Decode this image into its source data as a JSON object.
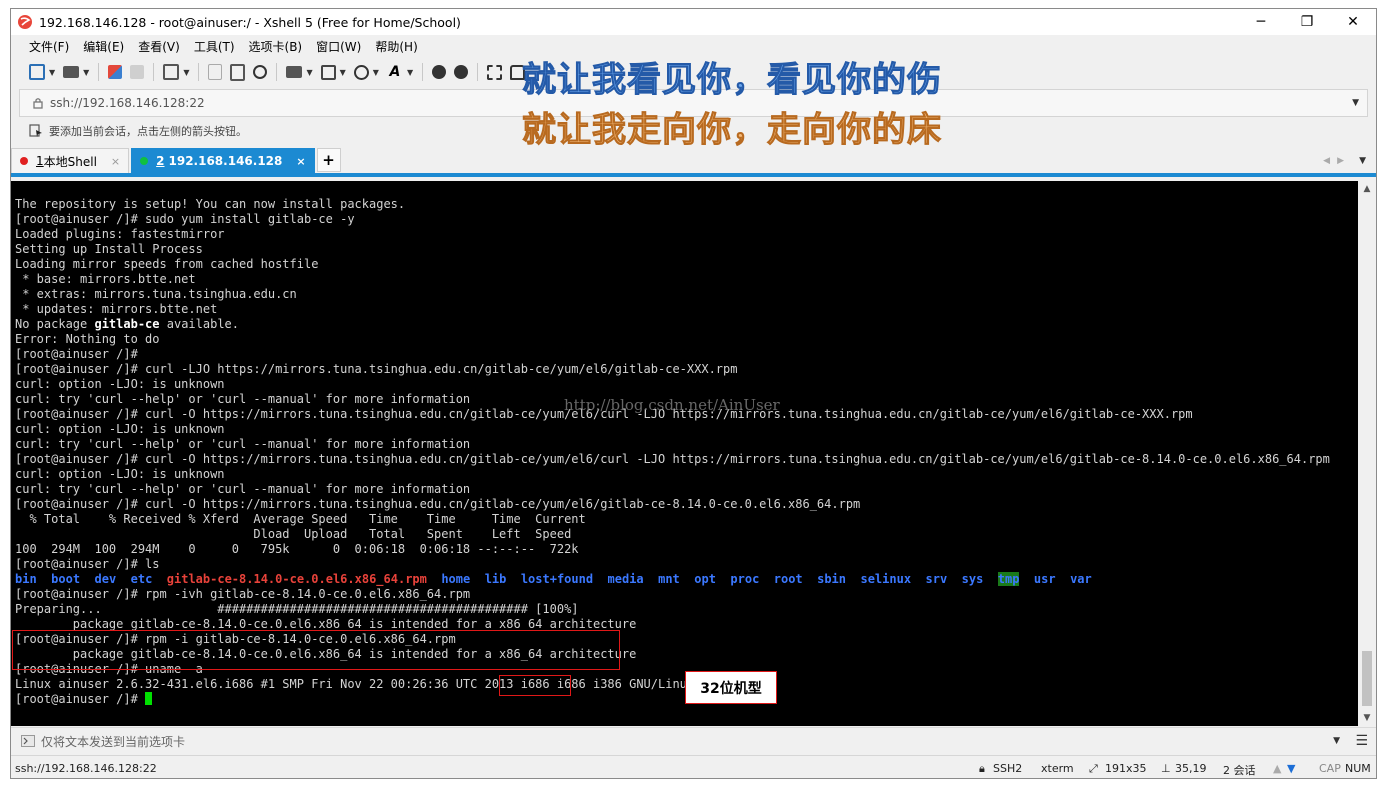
{
  "window": {
    "title": "192.168.146.128 - root@ainuser:/ - Xshell 5 (Free for Home/School)",
    "minimize_glyph": "─",
    "maximize_glyph": "❐",
    "close_glyph": "✕"
  },
  "menu": [
    "文件(F)",
    "编辑(E)",
    "查看(V)",
    "工具(T)",
    "选项卡(B)",
    "窗口(W)",
    "帮助(H)"
  ],
  "toolbar_icons": [
    "new-session-icon",
    "open-folder-icon",
    "connect-icon",
    "disconnect-icon",
    "properties-icon",
    "copy-icon",
    "paste-icon",
    "find-icon",
    "print-icon",
    "transfer-icon",
    "globe-icon",
    "font-icon",
    "xftp-icon",
    "xmanager-icon",
    "fullscreen-icon",
    "lock-icon",
    "keyboard-icon",
    "help-icon"
  ],
  "address": {
    "text": "ssh://192.168.146.128:22"
  },
  "info": {
    "text": "要添加当前会话，点击左侧的箭头按钮。"
  },
  "tabs": [
    {
      "number": "1",
      "label": "本地Shell",
      "dot_color": "#e02020",
      "active": false,
      "close_glyph": "×"
    },
    {
      "number": "2",
      "label": "192.168.146.128",
      "dot_color": "#10c040",
      "active": true,
      "close_glyph": "×"
    }
  ],
  "tab_add_glyph": "+",
  "lyrics": [
    "就让我看见你，看见你的伤",
    "就让我走向你，走向你的床"
  ],
  "watermark": "http://blog.csdn.net/AinUser",
  "terminal": {
    "lines": [
      "The repository is setup! You can now install packages.",
      "[root@ainuser /]# sudo yum install gitlab-ce -y",
      "Loaded plugins: fastestmirror",
      "Setting up Install Process",
      "Loading mirror speeds from cached hostfile",
      " * base: mirrors.btte.net",
      " * extras: mirrors.tuna.tsinghua.edu.cn",
      " * updates: mirrors.btte.net"
    ],
    "no_package": {
      "prefix": "No package ",
      "bold": "gitlab-ce",
      "suffix": " available."
    },
    "lines2": [
      "Error: Nothing to do",
      "[root@ainuser /]#",
      "[root@ainuser /]# curl -LJO https://mirrors.tuna.tsinghua.edu.cn/gitlab-ce/yum/el6/gitlab-ce-XXX.rpm",
      "curl: option -LJO: is unknown",
      "curl: try 'curl --help' or 'curl --manual' for more information",
      "[root@ainuser /]# curl -O https://mirrors.tuna.tsinghua.edu.cn/gitlab-ce/yum/el6/curl -LJO https://mirrors.tuna.tsinghua.edu.cn/gitlab-ce/yum/el6/gitlab-ce-XXX.rpm",
      "curl: option -LJO: is unknown",
      "curl: try 'curl --help' or 'curl --manual' for more information",
      "[root@ainuser /]# curl -O https://mirrors.tuna.tsinghua.edu.cn/gitlab-ce/yum/el6/curl -LJO https://mirrors.tuna.tsinghua.edu.cn/gitlab-ce/yum/el6/gitlab-ce-8.14.0-ce.0.el6.x86_64.rpm",
      "curl: option -LJO: is unknown",
      "curl: try 'curl --help' or 'curl --manual' for more information",
      "[root@ainuser /]# curl -O https://mirrors.tuna.tsinghua.edu.cn/gitlab-ce/yum/el6/gitlab-ce-8.14.0-ce.0.el6.x86_64.rpm",
      "  % Total    % Received % Xferd  Average Speed   Time    Time     Time  Current",
      "                                 Dload  Upload   Total   Spent    Left  Speed",
      "100  294M  100  294M    0     0   795k      0  0:06:18  0:06:18 --:--:--  722k",
      "[root@ainuser /]# ls"
    ],
    "ls": {
      "before": [
        "bin",
        "boot",
        "dev",
        "etc"
      ],
      "rpm": "gitlab-ce-8.14.0-ce.0.el6.x86_64.rpm",
      "after": [
        "home",
        "lib",
        "lost+found",
        "media",
        "mnt",
        "opt",
        "proc",
        "root",
        "sbin",
        "selinux",
        "srv",
        "sys"
      ],
      "tmp": "tmp",
      "end": [
        "usr",
        "var"
      ]
    },
    "lines3": [
      "[root@ainuser /]# rpm -ivh gitlab-ce-8.14.0-ce.0.el6.x86_64.rpm",
      "Preparing...                ########################################### [100%]",
      "        package gitlab-ce-8.14.0-ce.0.el6.x86_64 is intended for a x86_64 architecture",
      "[root@ainuser /]# rpm -i gitlab-ce-8.14.0-ce.0.el6.x86_64.rpm",
      "        package gitlab-ce-8.14.0-ce.0.el6.x86_64 is intended for a x86_64 architecture",
      "[root@ainuser /]# uname -a",
      "Linux ainuser 2.6.32-431.el6.i686 #1 SMP Fri Nov 22 00:26:36 UTC 2013 i686 i686 i386 GNU/Linux"
    ],
    "prompt": "[root@ainuser /]# "
  },
  "annotation": {
    "label": "32位机型"
  },
  "sendbar": {
    "placeholder": "仅将文本发送到当前选项卡"
  },
  "status": {
    "address": "ssh://192.168.146.128:22",
    "protocol": "SSH2",
    "term": "xterm",
    "size": "191x35",
    "cursor": "35,19",
    "sessions": "2 会话",
    "caps": "CAP",
    "num": "NUM"
  }
}
